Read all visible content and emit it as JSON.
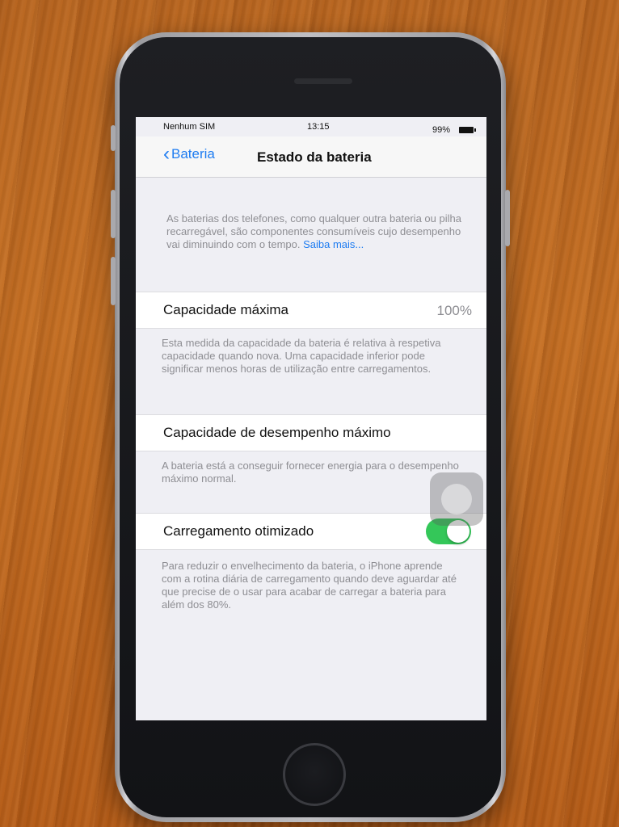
{
  "status_bar": {
    "carrier": "Nenhum SIM",
    "time": "13:15",
    "battery_percent": "99%"
  },
  "nav": {
    "back_label": "Bateria",
    "title": "Estado da bateria"
  },
  "intro": {
    "text": "As baterias dos telefones, como qualquer outra bateria ou pilha recarregável, são componentes consumíveis cujo desempenho vai diminuindo com o tempo. ",
    "link": "Saiba mais..."
  },
  "max_capacity": {
    "label": "Capacidade máxima",
    "value": "100%",
    "footer": "Esta medida da capacidade da bateria é relativa à respetiva capacidade quando nova. Uma capacidade inferior pode significar menos horas de utilização entre carregamentos."
  },
  "peak_performance": {
    "label": "Capacidade de desempenho máximo",
    "footer": "A bateria está a conseguir fornecer energia para o desempenho máximo normal."
  },
  "optimized_charging": {
    "label": "Carregamento otimizado",
    "enabled": true,
    "toggle_color": "#34c759",
    "footer": "Para reduzir o envelhecimento da bateria, o iPhone aprende com a rotina diária de carregamento quando deve aguardar até que precise de o usar para acabar de carregar a bateria para além dos 80%."
  },
  "colors": {
    "link": "#1e7cf1",
    "background": "#efeff4"
  },
  "icons": {
    "back": "chevron-left-icon",
    "battery": "battery-icon",
    "assistive_touch": "assistive-touch-icon"
  }
}
